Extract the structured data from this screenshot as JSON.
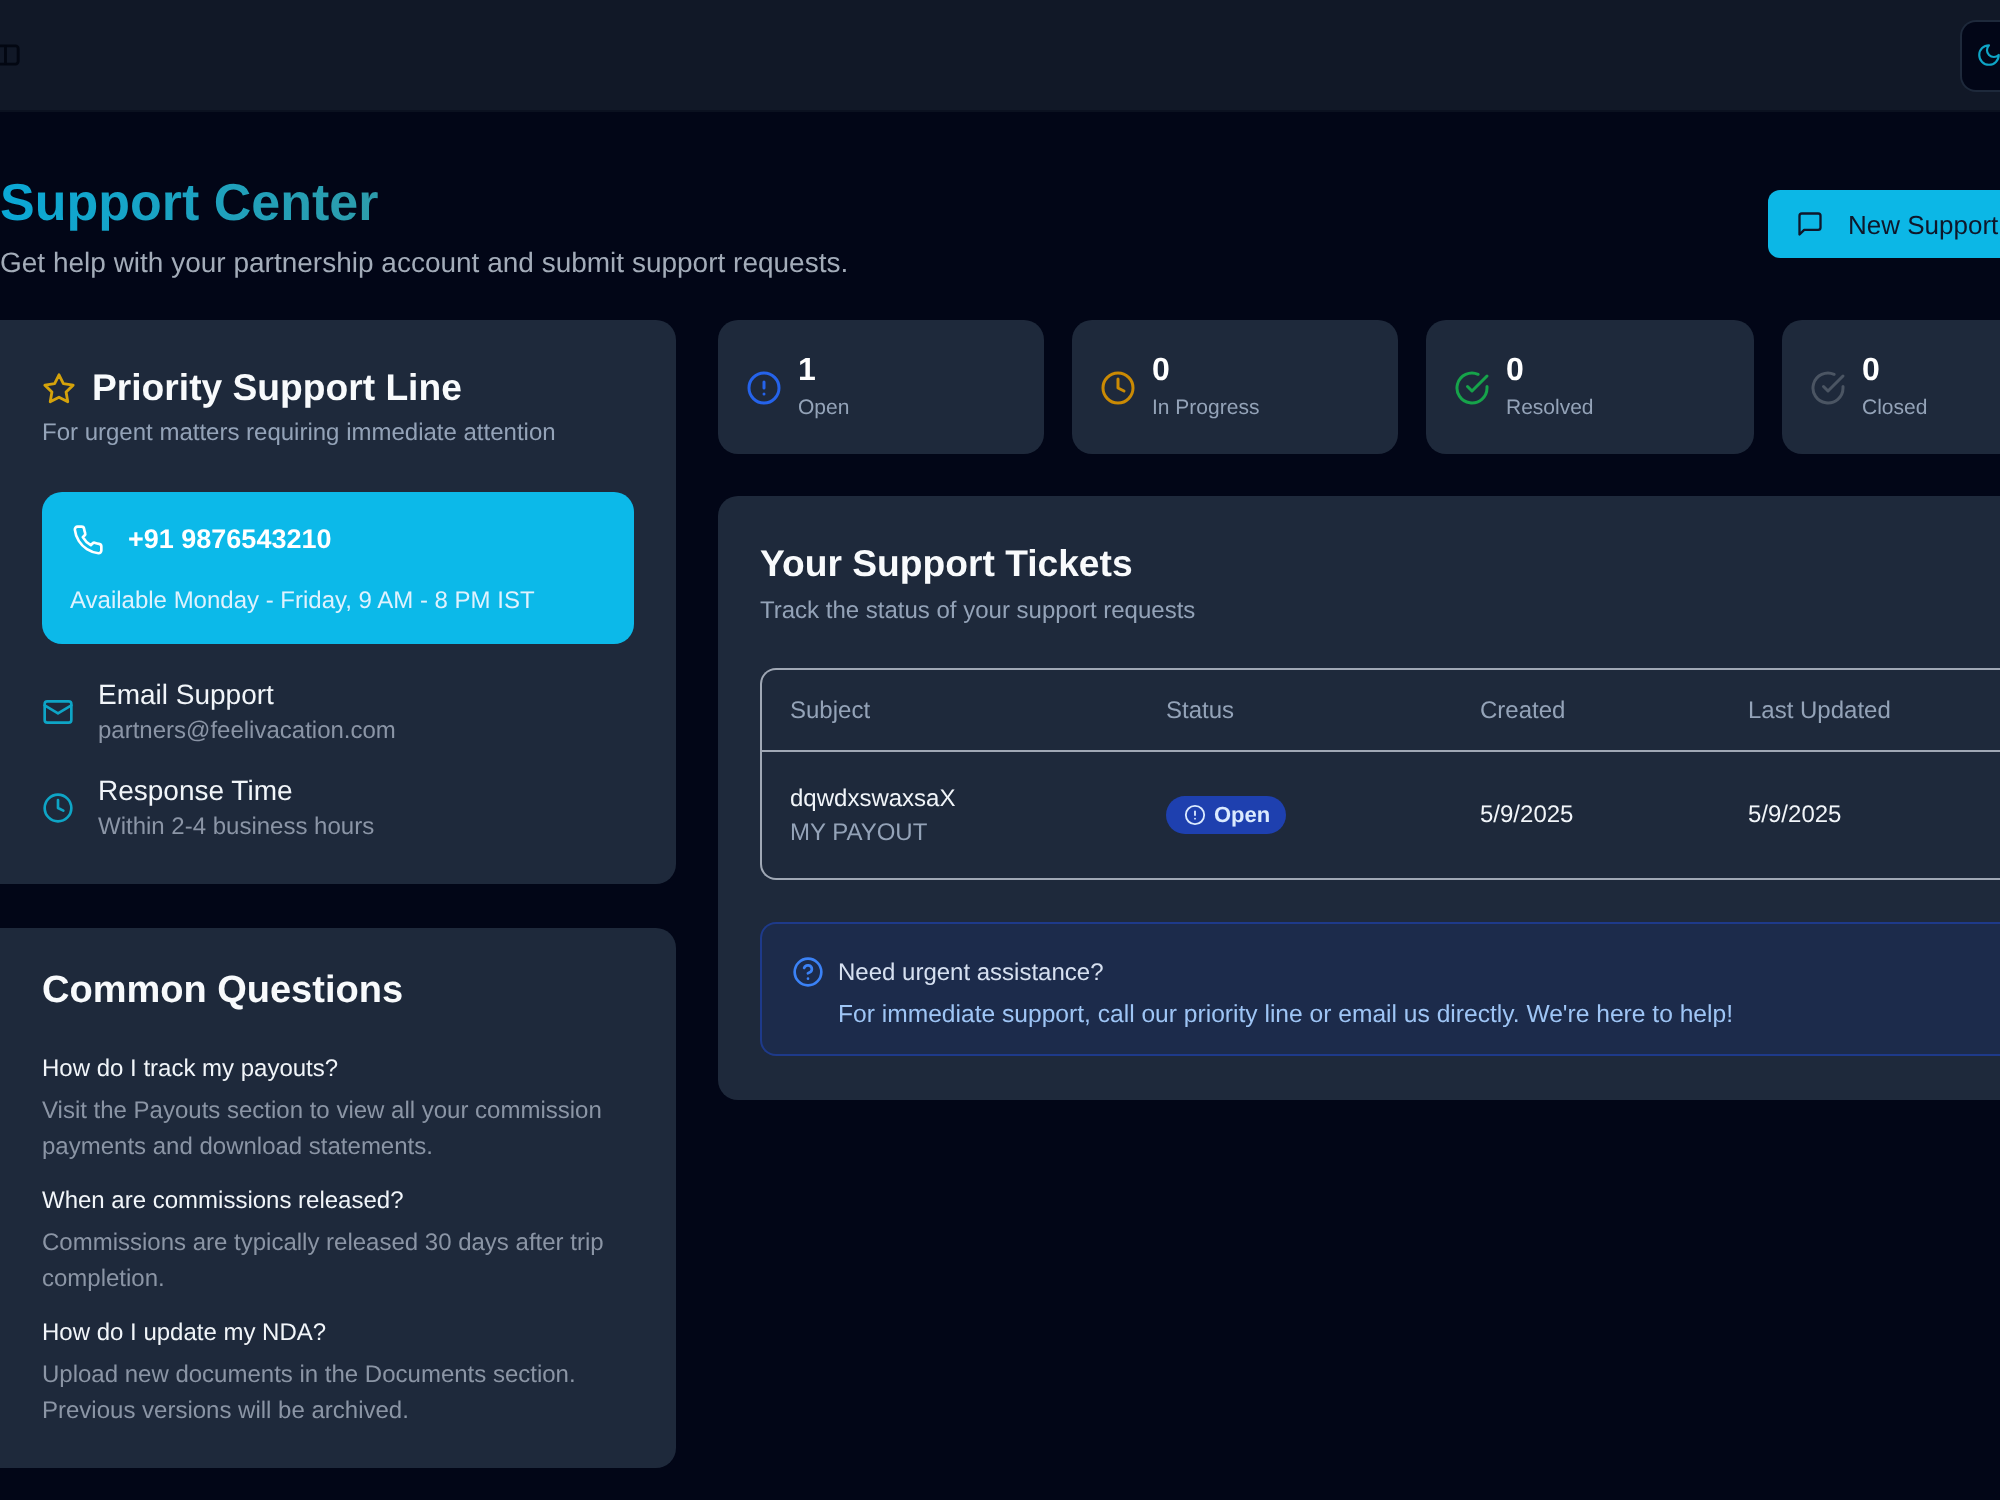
{
  "page_header": {
    "title": "Support Center",
    "subtitle": "Get help with your partnership account and submit support requests.",
    "action_button": "New Support"
  },
  "priority_card": {
    "title": "Priority Support Line",
    "subtitle": "For urgent matters requiring immediate attention",
    "phone": "+91 9876543210",
    "hours": "Available Monday - Friday, 9 AM - 8 PM IST",
    "contacts": [
      {
        "kind": "email",
        "label": "Email Support",
        "value": "partners@feelivacation.com"
      },
      {
        "kind": "response_time",
        "label": "Response Time",
        "value": "Within 2-4 business hours"
      }
    ]
  },
  "faq": {
    "title": "Common Questions",
    "items": [
      {
        "question": "How do I track my payouts?",
        "answer": "Visit the Payouts section to view all your commission payments and download statements."
      },
      {
        "question": "When are commissions released?",
        "answer": "Commissions are typically released 30 days after trip completion."
      },
      {
        "question": "How do I update my NDA?",
        "answer": "Upload new documents in the Documents section. Previous versions will be archived."
      }
    ]
  },
  "stats": [
    {
      "kind": "open",
      "count": "1",
      "label": "Open",
      "color": "#2563eb"
    },
    {
      "kind": "in_progress",
      "count": "0",
      "label": "In Progress",
      "color": "#ca8a04"
    },
    {
      "kind": "resolved",
      "count": "0",
      "label": "Resolved",
      "color": "#16a34a"
    },
    {
      "kind": "closed",
      "count": "0",
      "label": "Closed",
      "color": "#4b5563"
    }
  ],
  "tickets": {
    "title": "Your Support Tickets",
    "subtitle": "Track the status of your support requests",
    "columns": [
      "Subject",
      "Status",
      "Created",
      "Last Updated"
    ],
    "rows": [
      {
        "subject": "dqwdxswaxsaX",
        "category": "MY PAYOUT",
        "status": {
          "kind": "open",
          "label": "Open"
        },
        "created": "5/9/2025",
        "updated": "5/9/2025"
      }
    ]
  },
  "notice": {
    "title": "Need urgent assistance?",
    "text": "For immediate support, call our priority line or email us directly. We're here to help!"
  }
}
